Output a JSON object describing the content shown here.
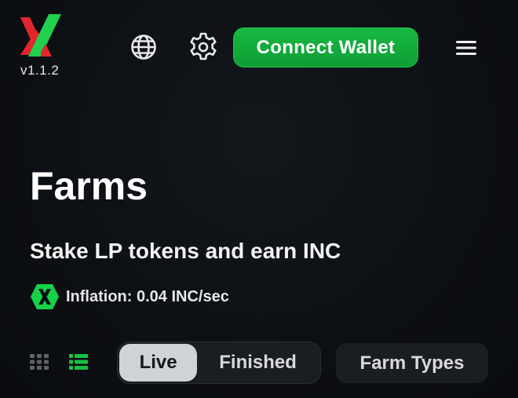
{
  "header": {
    "version": "v1.1.2",
    "connect_label": "Connect Wallet",
    "icons": [
      "globe-icon",
      "gear-icon",
      "hamburger-menu-icon"
    ]
  },
  "main": {
    "title": "Farms",
    "subtitle": "Stake LP tokens and earn INC",
    "inflation": "Inflation: 0.04 INC/sec"
  },
  "filters": {
    "tabs": [
      {
        "label": "Live",
        "active": true
      },
      {
        "label": "Finished",
        "active": false
      }
    ],
    "farm_types_label": "Farm Types",
    "view_modes": [
      {
        "icon": "grid-view-icon",
        "active": false
      },
      {
        "icon": "list-view-icon",
        "active": true
      }
    ]
  },
  "colors": {
    "accent_green": "#14b13f",
    "logo_red": "#e3262b",
    "background": "#0c0f13",
    "active_tab_bg": "#cfd2d6"
  }
}
